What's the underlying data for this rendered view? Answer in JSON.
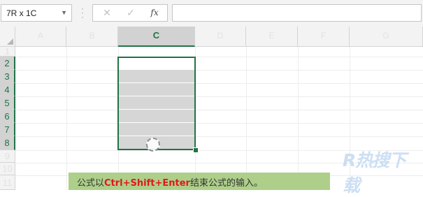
{
  "formula_bar": {
    "name_box": "7R x 1C",
    "cancel_icon": "✕",
    "enter_icon": "✓",
    "fx_label": "fx",
    "formula_value": ""
  },
  "grid": {
    "columns": [
      "A",
      "B",
      "C",
      "D",
      "E",
      "F",
      "G"
    ],
    "selected_column": "C",
    "rows": [
      "1",
      "2",
      "3",
      "4",
      "5",
      "6",
      "7",
      "8",
      "9",
      "10",
      "11"
    ],
    "selected_rows": [
      "2",
      "3",
      "4",
      "5",
      "6",
      "7",
      "8"
    ]
  },
  "hint": {
    "prefix": "公式以",
    "keys": "Ctrl+Shift+Enter",
    "suffix": "结束公式的输入。"
  },
  "watermark": {
    "text": "R热搜下载"
  },
  "colors": {
    "accent": "#217346",
    "hint_bg": "#aecf8a",
    "key_text": "#e0191c"
  }
}
